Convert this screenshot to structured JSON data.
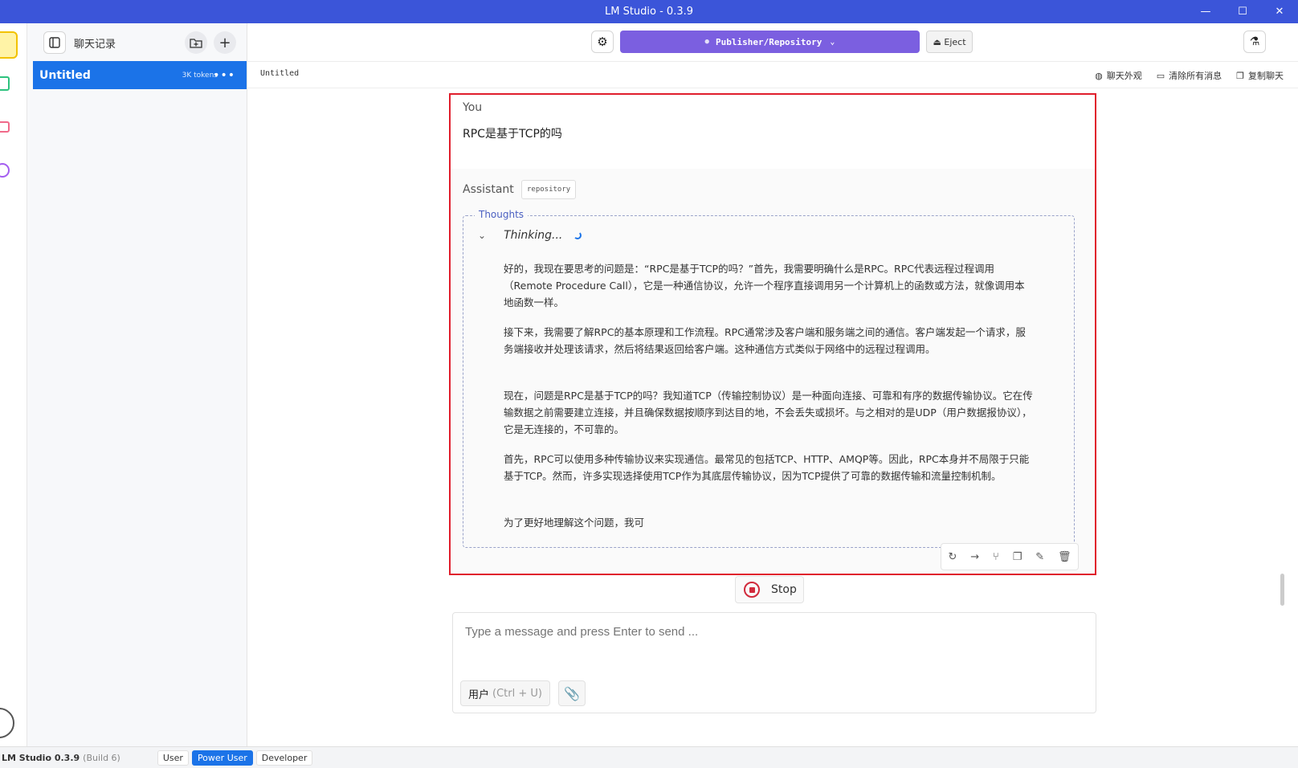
{
  "window": {
    "title": "LM Studio - 0.3.9",
    "controls": [
      "minimize-icon",
      "maximize-icon",
      "close-icon"
    ]
  },
  "rail": {
    "items": [
      "chat-icon",
      "terminal-icon",
      "folder-icon",
      "search-icon"
    ]
  },
  "sidebar": {
    "title": "聊天记录",
    "chats": [
      {
        "title": "Untitled",
        "tokens": "3K tokens"
      }
    ]
  },
  "toolbar": {
    "model": "Publisher/Repository",
    "eject_label": "Eject"
  },
  "chat": {
    "name": "Untitled",
    "actions": {
      "appearance": "聊天外观",
      "clear": "清除所有消息",
      "copy": "复制聊天"
    },
    "user_label": "You",
    "user_message": "RPC是基于TCP的吗",
    "assistant_label": "Assistant",
    "assistant_tag": "repository",
    "thoughts_label": "Thoughts",
    "thinking_label": "Thinking...",
    "thought_paragraphs": [
      "好的，我现在要思考的问题是：“RPC是基于TCP的吗？”首先，我需要明确什么是RPC。RPC代表远程过程调用（Remote Procedure Call），它是一种通信协议，允许一个程序直接调用另一个计算机上的函数或方法，就像调用本地函数一样。",
      "接下来，我需要了解RPC的基本原理和工作流程。RPC通常涉及客户端和服务端之间的通信。客户端发起一个请求，服务端接收并处理该请求，然后将结果返回给客户端。这种通信方式类似于网络中的远程过程调用。",
      "现在，问题是RPC是基于TCP的吗？我知道TCP（传输控制协议）是一种面向连接、可靠和有序的数据传输协议。它在传输数据之前需要建立连接，并且确保数据按顺序到达目的地，不会丢失或损坏。与之相对的是UDP（用户数据报协议），它是无连接的，不可靠的。",
      "首先，RPC可以使用多种传输协议来实现通信。最常见的包括TCP、HTTP、AMQP等。因此，RPC本身并不局限于只能基于TCP。然而，许多实现选择使用TCP作为其底层传输协议，因为TCP提供了可靠的数据传输和流量控制机制。",
      "为了更好地理解这个问题，我可"
    ],
    "stop_label": "Stop",
    "input_placeholder": "Type a message and press Enter to send ...",
    "role_label": "用户",
    "role_shortcut": "(Ctrl + U)"
  },
  "status": {
    "app": "LM Studio 0.3.9",
    "build": "(Build 6)",
    "modes": [
      "User",
      "Power User",
      "Developer"
    ],
    "active_mode": "Power User"
  }
}
